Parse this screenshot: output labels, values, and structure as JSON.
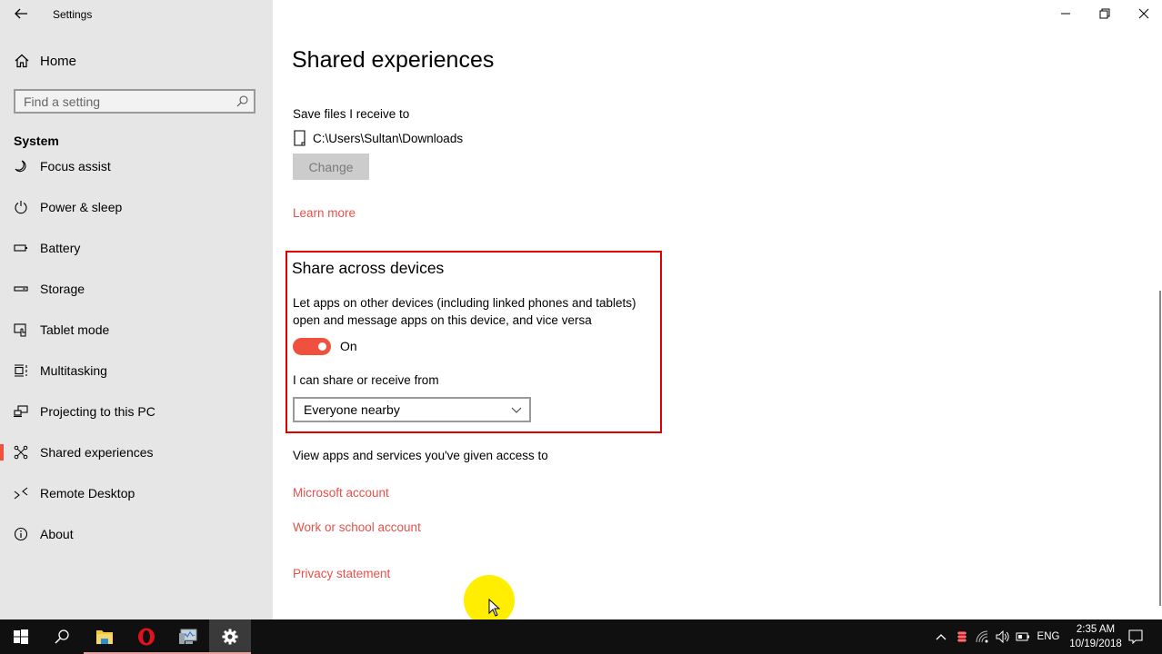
{
  "window": {
    "app_title": "Settings",
    "controls": {
      "minimize": "minimize-icon",
      "restore": "restore-icon",
      "close": "close-icon"
    }
  },
  "sidebar": {
    "home_label": "Home",
    "search_placeholder": "Find a setting",
    "section_label": "System",
    "items": [
      {
        "label": "Focus assist",
        "icon": "moon-icon",
        "active": false
      },
      {
        "label": "Power & sleep",
        "icon": "power-icon",
        "active": false
      },
      {
        "label": "Battery",
        "icon": "battery-icon",
        "active": false
      },
      {
        "label": "Storage",
        "icon": "storage-icon",
        "active": false
      },
      {
        "label": "Tablet mode",
        "icon": "tablet-mode-icon",
        "active": false
      },
      {
        "label": "Multitasking",
        "icon": "multitasking-icon",
        "active": false
      },
      {
        "label": "Projecting to this PC",
        "icon": "projecting-icon",
        "active": false
      },
      {
        "label": "Shared experiences",
        "icon": "shared-experiences-icon",
        "active": true
      },
      {
        "label": "Remote Desktop",
        "icon": "remote-desktop-icon",
        "active": false
      },
      {
        "label": "About",
        "icon": "info-icon",
        "active": false
      }
    ]
  },
  "main": {
    "title": "Shared experiences",
    "save_files_label": "Save files I receive to",
    "save_path": "C:\\Users\\Sultan\\Downloads",
    "change_button": "Change",
    "learn_more": "Learn more",
    "share_section": {
      "title": "Share across devices",
      "description_line1": "Let apps on other devices (including linked phones and tablets)",
      "description_line2": "open and message apps on this device, and vice versa",
      "toggle_state": "On",
      "toggle_on": true,
      "share_from_label": "I can share or receive from",
      "share_from_value": "Everyone nearby"
    },
    "view_apps_label": "View apps and services you've given access to",
    "links": {
      "microsoft_account": "Microsoft account",
      "work_school_account": "Work or school account",
      "privacy_statement": "Privacy statement"
    }
  },
  "colors": {
    "accent": "#f0513e",
    "link": "#e8504a",
    "highlight_box": "#e00000",
    "sidebar_bg": "#e6e6e6",
    "taskbar_bg": "#101010"
  },
  "taskbar": {
    "apps": [
      "start-icon",
      "search-icon",
      "file-explorer-icon",
      "opera-icon",
      "performance-monitor-icon",
      "settings-icon"
    ],
    "tray": {
      "language": "ENG",
      "time": "2:35 AM",
      "date": "10/19/2018"
    }
  }
}
